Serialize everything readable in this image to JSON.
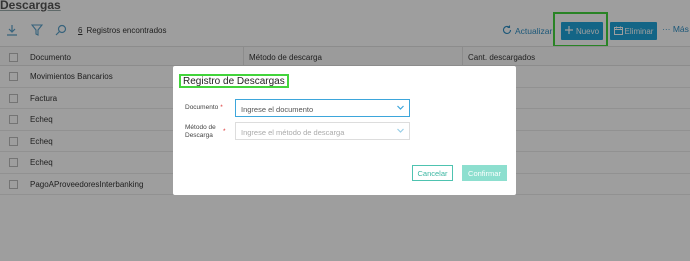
{
  "page": {
    "title": "Descargas"
  },
  "toolbar": {
    "count_number": "6",
    "count_label": "Registros encontrados",
    "actualizar_label": "Actualizar",
    "nuevo_label": "Nuevo",
    "eliminar_label": "Eliminar",
    "mas_label": "··· Más"
  },
  "table": {
    "columns": [
      "Documento",
      "Método de descarga",
      "Cant. descargados"
    ],
    "rows": [
      {
        "documento": "Movimientos Bancarios"
      },
      {
        "documento": "Factura"
      },
      {
        "documento": "Echeq"
      },
      {
        "documento": "Echeq"
      },
      {
        "documento": "Echeq"
      },
      {
        "documento": "PagoAProveedoresInterbanking"
      }
    ]
  },
  "modal": {
    "title": "Registro de Descargas",
    "documento_label": "Documento",
    "documento_placeholder": "Ingrese el documento",
    "metodo_label_1": "Método de",
    "metodo_label_2": "Descarga",
    "metodo_placeholder": "Ingrese el método de descarga",
    "required_mark": "*",
    "cancel_label": "Cancelar",
    "confirm_label": "Confirmar"
  },
  "colors": {
    "accent": "#1fa3d8",
    "highlight": "#43d43c",
    "teal": "#4ec3b0"
  },
  "icons": [
    "download-icon",
    "filter-icon",
    "search-icon",
    "refresh-icon",
    "plus-icon",
    "calendar-trash-icon",
    "chevron-down-icon"
  ]
}
